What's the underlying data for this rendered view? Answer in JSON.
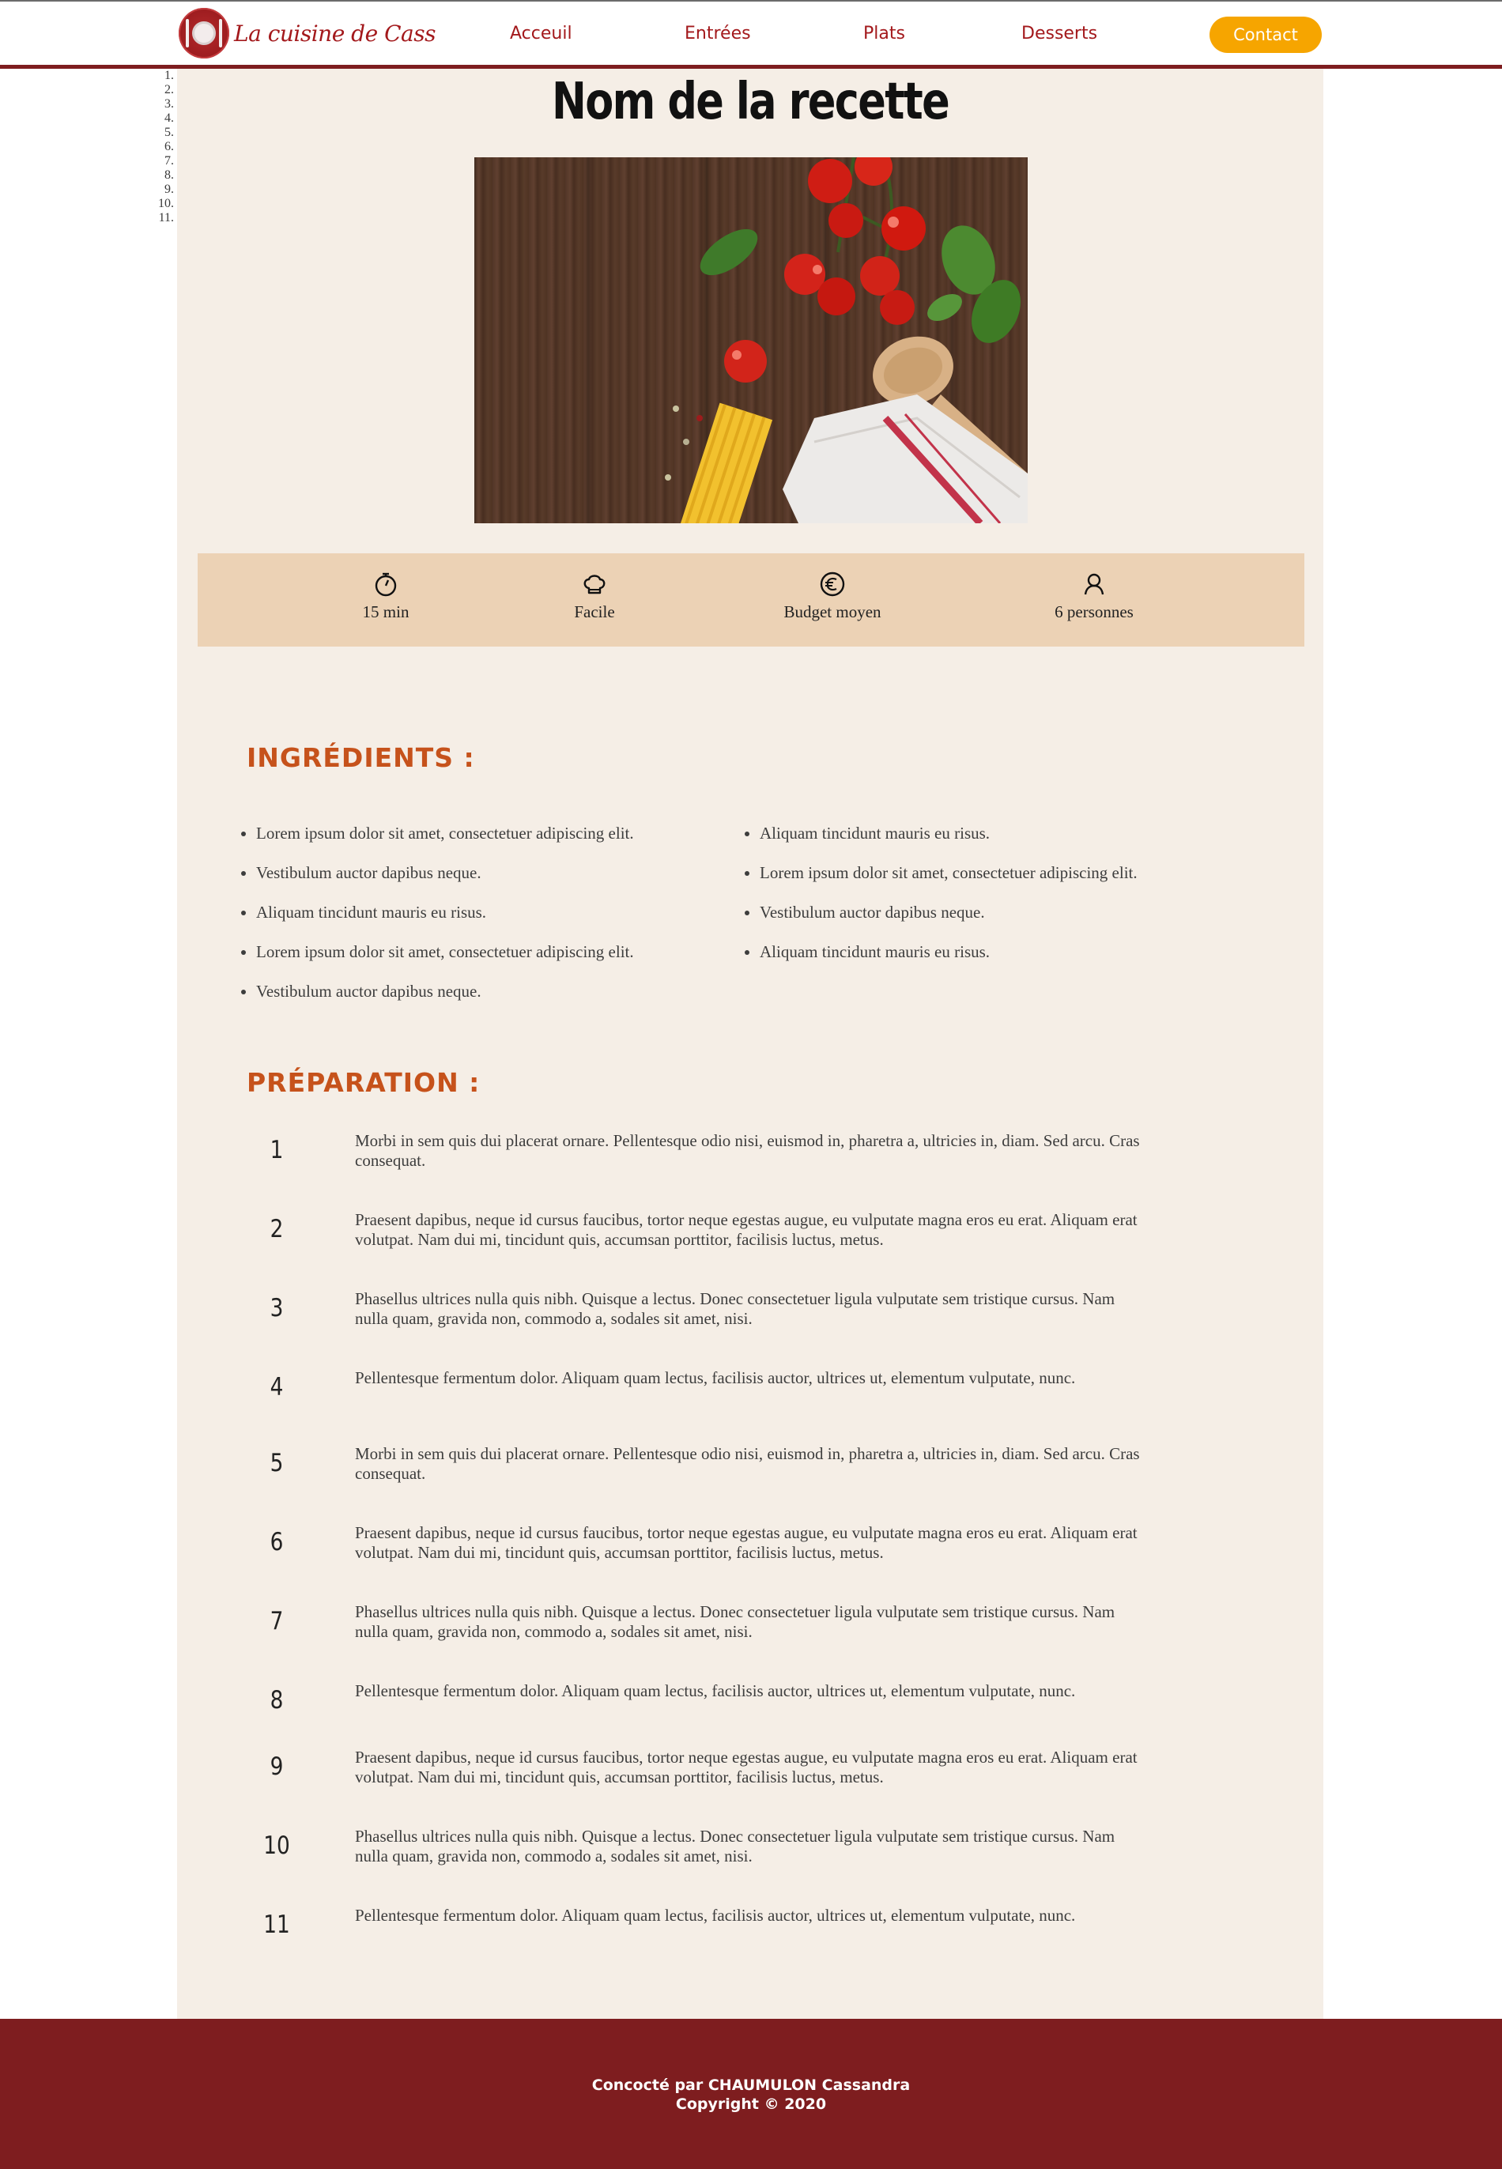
{
  "header": {
    "logo_text": "La cuisine de Cass",
    "nav": [
      {
        "label": "Acceuil"
      },
      {
        "label": "Entrées"
      },
      {
        "label": "Plats"
      },
      {
        "label": "Desserts"
      }
    ],
    "contact_label": "Contact"
  },
  "recipe": {
    "title": "Nom de la recette",
    "info": [
      {
        "icon": "stopwatch-icon",
        "label": "15 min"
      },
      {
        "icon": "chef-hat-icon",
        "label": "Facile"
      },
      {
        "icon": "euro-icon",
        "label": "Budget moyen"
      },
      {
        "icon": "person-icon",
        "label": "6 personnes"
      }
    ],
    "ingredients_title": "INGRÉDIENTS :",
    "ingredients_left": [
      "Lorem ipsum dolor sit amet, consectetuer adipiscing elit.",
      "Vestibulum auctor dapibus neque.",
      "Aliquam tincidunt mauris eu risus.",
      "Lorem ipsum dolor sit amet, consectetuer adipiscing elit.",
      "Vestibulum auctor dapibus neque."
    ],
    "ingredients_right": [
      "Aliquam tincidunt mauris eu risus.",
      "Lorem ipsum dolor sit amet, consectetuer adipiscing elit.",
      "Vestibulum auctor dapibus neque.",
      "Aliquam tincidunt mauris eu risus."
    ],
    "preparation_title": "PRÉPARATION :",
    "steps": [
      {
        "num": "1",
        "text": "Morbi in sem quis dui placerat ornare. Pellentesque odio nisi, euismod in, pharetra a, ultricies in, diam. Sed arcu. Cras consequat."
      },
      {
        "num": "2",
        "text": "Praesent dapibus, neque id cursus faucibus, tortor neque egestas augue, eu vulputate magna eros eu erat. Aliquam erat volutpat. Nam dui mi, tincidunt quis, accumsan porttitor, facilisis luctus, metus."
      },
      {
        "num": "3",
        "text": "Phasellus ultrices nulla quis nibh. Quisque a lectus. Donec consectetuer ligula vulputate sem tristique cursus. Nam nulla quam, gravida non, commodo a, sodales sit amet, nisi."
      },
      {
        "num": "4",
        "text": "Pellentesque fermentum dolor. Aliquam quam lectus, facilisis auctor, ultrices ut, elementum vulputate, nunc."
      },
      {
        "num": "5",
        "text": "Morbi in sem quis dui placerat ornare. Pellentesque odio nisi, euismod in, pharetra a, ultricies in, diam. Sed arcu. Cras consequat."
      },
      {
        "num": "6",
        "text": "Praesent dapibus, neque id cursus faucibus, tortor neque egestas augue, eu vulputate magna eros eu erat. Aliquam erat volutpat. Nam dui mi, tincidunt quis, accumsan porttitor, facilisis luctus, metus."
      },
      {
        "num": "7",
        "text": "Phasellus ultrices nulla quis nibh. Quisque a lectus. Donec consectetuer ligula vulputate sem tristique cursus. Nam nulla quam, gravida non, commodo a, sodales sit amet, nisi."
      },
      {
        "num": "8",
        "text": "Pellentesque fermentum dolor. Aliquam quam lectus, facilisis auctor, ultrices ut, elementum vulputate, nunc."
      },
      {
        "num": "9",
        "text": "Praesent dapibus, neque id cursus faucibus, tortor neque egestas augue, eu vulputate magna eros eu erat. Aliquam erat volutpat. Nam dui mi, tincidunt quis, accumsan porttitor, facilisis luctus, metus."
      },
      {
        "num": "10",
        "text": "Phasellus ultrices nulla quis nibh. Quisque a lectus. Donec consectetuer ligula vulputate sem tristique cursus. Nam nulla quam, gravida non, commodo a, sodales sit amet, nisi."
      },
      {
        "num": "11",
        "text": "Pellentesque fermentum dolor. Aliquam quam lectus, facilisis auctor, ultrices ut, elementum vulputate, nunc."
      }
    ]
  },
  "footer": {
    "line1": "Concocté par CHAUMULON Cassandra",
    "line2": "Copyright © 2020"
  },
  "colors": {
    "brand_red": "#7e1d1f",
    "nav_text": "#a3191c",
    "contact_button": "#f6a500",
    "page_background": "#f5eee6",
    "info_bar": "#ecd2b5",
    "section_title": "#c6521b"
  }
}
